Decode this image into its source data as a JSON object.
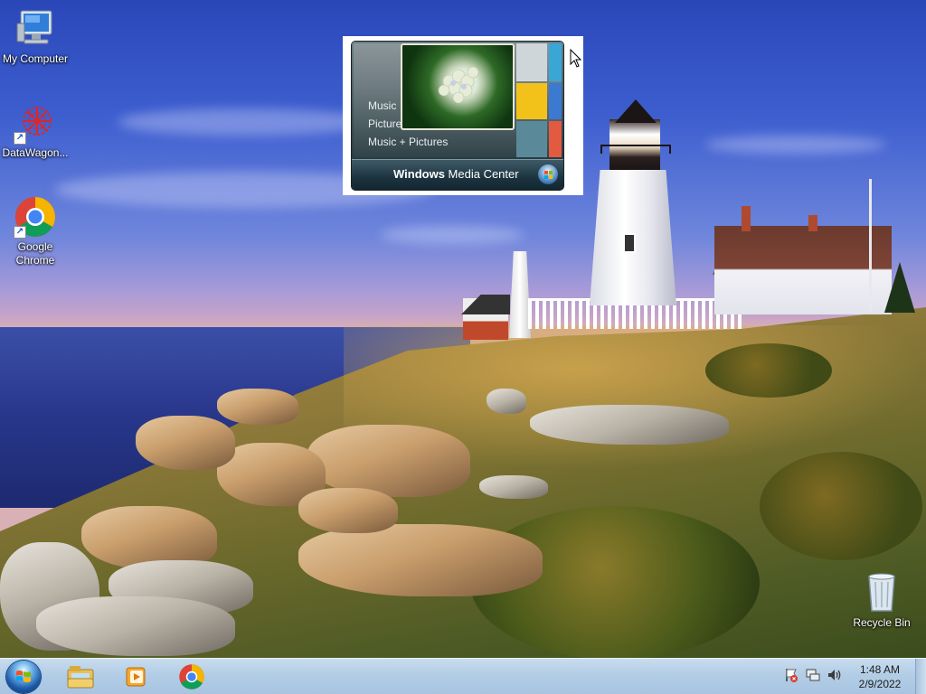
{
  "desktop": {
    "icons": [
      {
        "label": "My Computer",
        "icon": "computer-icon"
      },
      {
        "label": "DataWagon...",
        "icon": "datawagon-icon"
      },
      {
        "label": "Google Chrome",
        "icon": "chrome-icon"
      },
      {
        "label": "Recycle Bin",
        "icon": "recycle-bin-icon"
      }
    ]
  },
  "media_center_thumbnail": {
    "menu_items": [
      "Music",
      "Pictures",
      "Music + Pictures"
    ],
    "title_bold": "Windows",
    "title_rest": " Media Center",
    "icon": "windows-logo-icon"
  },
  "taskbar": {
    "start_button": "start-orb-icon",
    "pinned": [
      {
        "name": "file-explorer",
        "icon": "folder-icon"
      },
      {
        "name": "media-center",
        "icon": "media-player-icon"
      },
      {
        "name": "chrome",
        "icon": "chrome-icon"
      }
    ],
    "tray_icons": [
      "action-center-flag-icon",
      "network-icon",
      "volume-icon"
    ],
    "clock": {
      "time": "1:48 AM",
      "date": "2/9/2022"
    }
  },
  "colors": {
    "taskbar": "#b3cde6",
    "sky_top": "#2a47b8",
    "sea": "#28368a"
  }
}
